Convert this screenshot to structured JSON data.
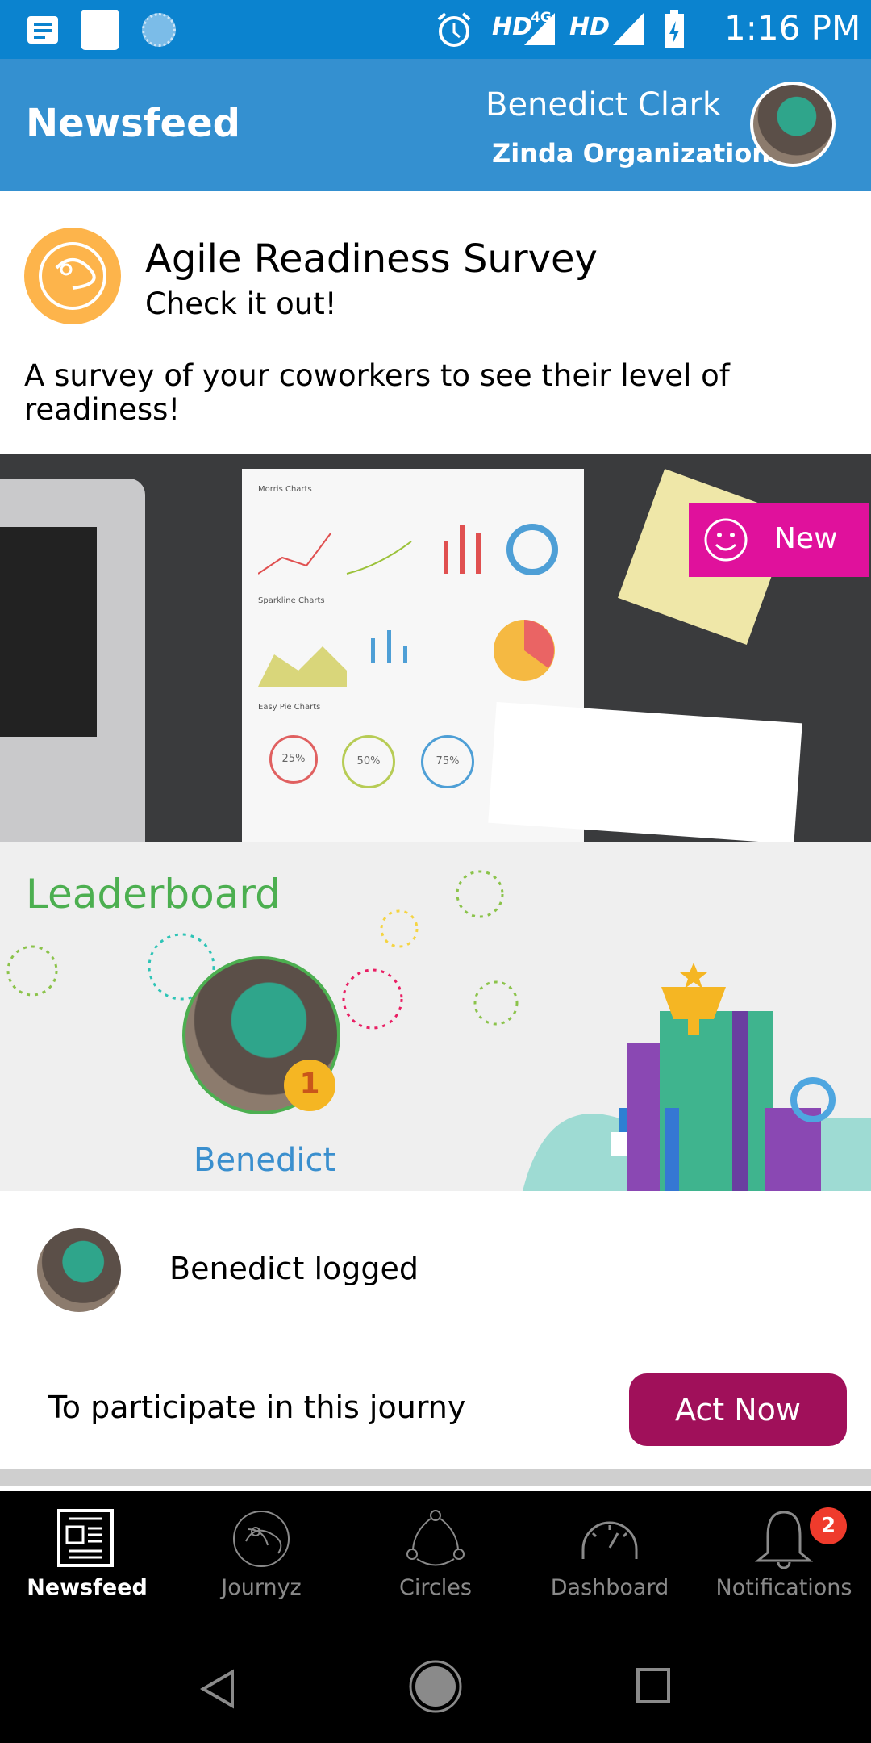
{
  "status_bar": {
    "time": "1:16 PM",
    "network1": "HD",
    "network1_type": "4G",
    "network2": "HD",
    "icons": [
      "notes-icon",
      "square-app-icon",
      "loading-icon",
      "alarm-icon",
      "signal-icon",
      "signal-icon",
      "battery-charging-icon"
    ]
  },
  "header": {
    "title": "Newsfeed",
    "user_name": "Benedict Clark",
    "organization": "Zinda Organization"
  },
  "survey_card": {
    "title": "Agile Readiness Survey",
    "subtitle": "Check it out!",
    "description": "A survey of your coworkers to see their level of readiness!",
    "badge_label": "New",
    "hero_labels": {
      "sheet_title": "Morris Charts",
      "section2": "Sparkline Charts",
      "section3": "Easy Pie Charts",
      "pie1": "25%",
      "pie2": "50%",
      "pie3": "75%"
    }
  },
  "leaderboard": {
    "title": "Leaderboard",
    "top_user": "Benedict",
    "rank": "1",
    "accent": "#4caf50",
    "name_color": "#3a8fce"
  },
  "activity": {
    "text": "Benedict logged",
    "prompt": "To participate in this journy",
    "button": "Act Now",
    "button_color": "#a0105a"
  },
  "bottom_nav": {
    "items": [
      {
        "label": "Newsfeed",
        "icon": "newspaper-icon",
        "active": true
      },
      {
        "label": "Journyz",
        "icon": "journyz-icon"
      },
      {
        "label": "Circles",
        "icon": "circles-icon"
      },
      {
        "label": "Dashboard",
        "icon": "speedometer-icon"
      },
      {
        "label": "Notifications",
        "icon": "bell-icon",
        "badge": "2"
      }
    ]
  }
}
